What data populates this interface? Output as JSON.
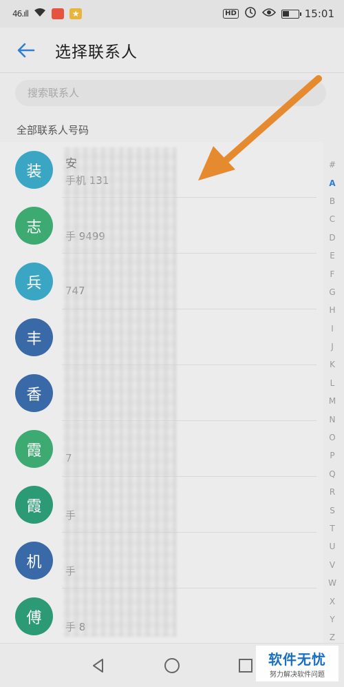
{
  "status_bar": {
    "signal": "46.ıll",
    "time": "15:01",
    "hd_label": "HD"
  },
  "header": {
    "title": "选择联系人"
  },
  "search": {
    "placeholder": "搜索联系人"
  },
  "section": {
    "title": "全部联系人号码"
  },
  "contacts": [
    {
      "avatar": "装",
      "color": "#3aa6c4",
      "name": "安",
      "phone": "手机 131"
    },
    {
      "avatar": "志",
      "color": "#3daa72",
      "name": "",
      "phone": "手    9499"
    },
    {
      "avatar": "兵",
      "color": "#3aa6c4",
      "name": "",
      "phone": "747"
    },
    {
      "avatar": "丰",
      "color": "#3a69a8",
      "name": "",
      "phone": ""
    },
    {
      "avatar": "香",
      "color": "#3a69a8",
      "name": "",
      "phone": ""
    },
    {
      "avatar": "霞",
      "color": "#3daa72",
      "name": "",
      "phone": "7"
    },
    {
      "avatar": "霞",
      "color": "#2c9a74",
      "name": "",
      "phone": "手"
    },
    {
      "avatar": "机",
      "color": "#3a69a8",
      "name": "",
      "phone": "手"
    },
    {
      "avatar": "傅",
      "color": "#2c9a74",
      "name": "",
      "phone": "手    8"
    }
  ],
  "index_letters": [
    "#",
    "A",
    "B",
    "C",
    "D",
    "E",
    "F",
    "G",
    "H",
    "I",
    "J",
    "K",
    "L",
    "M",
    "N",
    "O",
    "P",
    "Q",
    "R",
    "S",
    "T",
    "U",
    "V",
    "W",
    "X",
    "Y",
    "Z"
  ],
  "index_active": "A",
  "watermark": {
    "main": "软件无忧",
    "sub": "努力解决软件问题"
  },
  "colors": {
    "accent_blue": "#2c7fd1",
    "arrow_orange": "#e58a2e"
  }
}
